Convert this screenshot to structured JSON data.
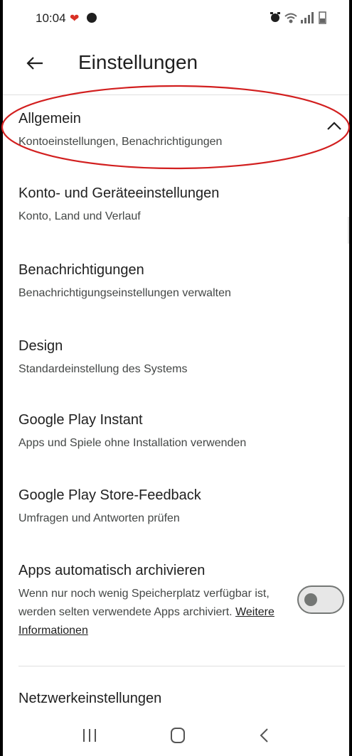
{
  "status_bar": {
    "time": "10:04",
    "icons": [
      "heart-icon",
      "app-icon",
      "alarm-icon",
      "wifi-icon",
      "signal-icon",
      "battery-icon"
    ],
    "heart_color": "#d93025"
  },
  "header": {
    "title": "Einstellungen",
    "back_icon": "arrow-left-icon"
  },
  "sections": [
    {
      "title": "Allgemein",
      "subtitle": "Kontoeinstellungen, Benachrichtigungen",
      "expanded": true
    },
    {
      "title": "Konto- und Geräteeinstellungen",
      "subtitle": "Konto, Land und Verlauf"
    },
    {
      "title": "Benachrichtigungen",
      "subtitle": "Benachrichtigungseinstellungen verwalten"
    },
    {
      "title": "Design",
      "subtitle": "Standardeinstellung des Systems"
    },
    {
      "title": "Google Play Instant",
      "subtitle": "Apps und Spiele ohne Installation verwenden"
    },
    {
      "title": "Google Play Store-Feedback",
      "subtitle": "Umfragen und Antworten prüfen"
    }
  ],
  "archive": {
    "title": "Apps automatisch archivieren",
    "description": "Wenn nur noch wenig Speicherplatz verfügbar ist, werden selten verwendete Apps archiviert.",
    "link": "Weitere Informationen",
    "toggle_on": false
  },
  "network": {
    "title": "Netzwerkeinstellungen"
  },
  "highlight_color": "#d21f1f",
  "nav_icons": [
    "recent-apps-icon",
    "home-icon",
    "back-nav-icon"
  ]
}
